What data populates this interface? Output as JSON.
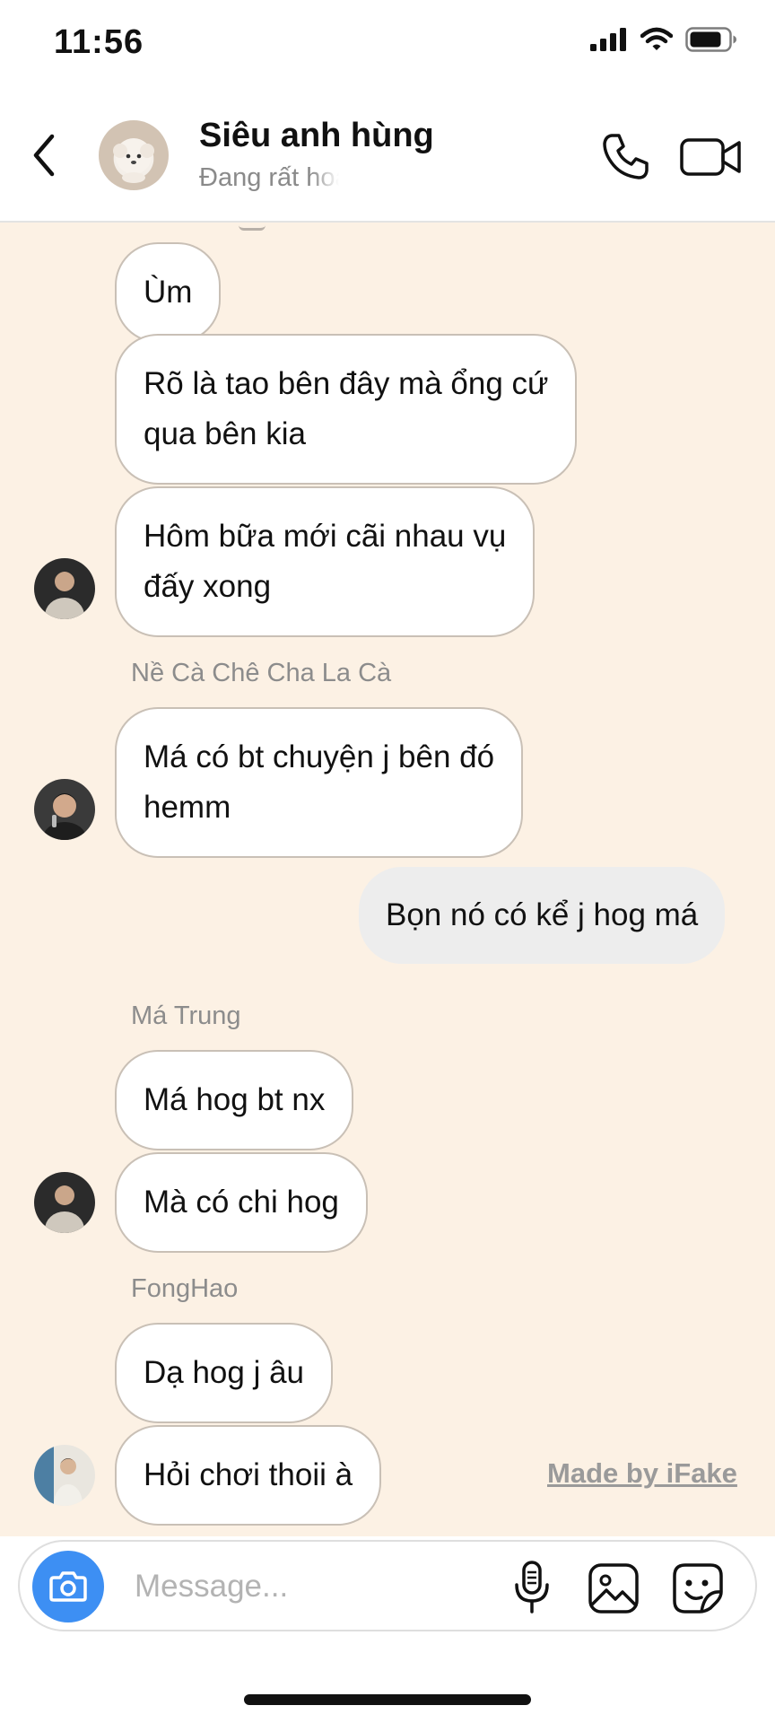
{
  "status_bar": {
    "time": "11:56"
  },
  "header": {
    "title": "Siêu anh hùng",
    "subtitle": "Đang rất hoạt động"
  },
  "messages": [
    {
      "id": "m1",
      "text": "Ùm"
    },
    {
      "id": "m2",
      "text": "Rõ là tao bên đây mà ổng cứ\nqua bên kia"
    },
    {
      "id": "m3",
      "text": "Hôm bữa mới cãi nhau vụ\nđấy xong"
    },
    {
      "id": "s2",
      "sender": "Nề Cà Chê Cha La Cà"
    },
    {
      "id": "m4",
      "text": "Má có bt chuyện j bên đó\nhemm"
    },
    {
      "id": "m5",
      "text": "Bọn nó có kể j hog má"
    },
    {
      "id": "s3",
      "sender": "Má Trung"
    },
    {
      "id": "m6",
      "text": "Má hog bt nx"
    },
    {
      "id": "m7",
      "text": "Mà có chi hog"
    },
    {
      "id": "s4",
      "sender": "FongHao"
    },
    {
      "id": "m8",
      "text": "Dạ hog j âu"
    },
    {
      "id": "m9",
      "text": "Hỏi chơi thoii à"
    }
  ],
  "watermark": "Made by iFake",
  "composer": {
    "placeholder": "Message..."
  },
  "icons": {
    "back": "chevron-left-icon",
    "call": "phone-icon",
    "video": "video-camera-icon",
    "camera": "camera-icon",
    "mic": "microphone-icon",
    "gallery": "image-icon",
    "sticker": "sticker-icon"
  },
  "colors": {
    "chat_background": "#fcf1e4",
    "camera_button": "#3d8ff3",
    "outgoing_bubble": "#ededed"
  }
}
